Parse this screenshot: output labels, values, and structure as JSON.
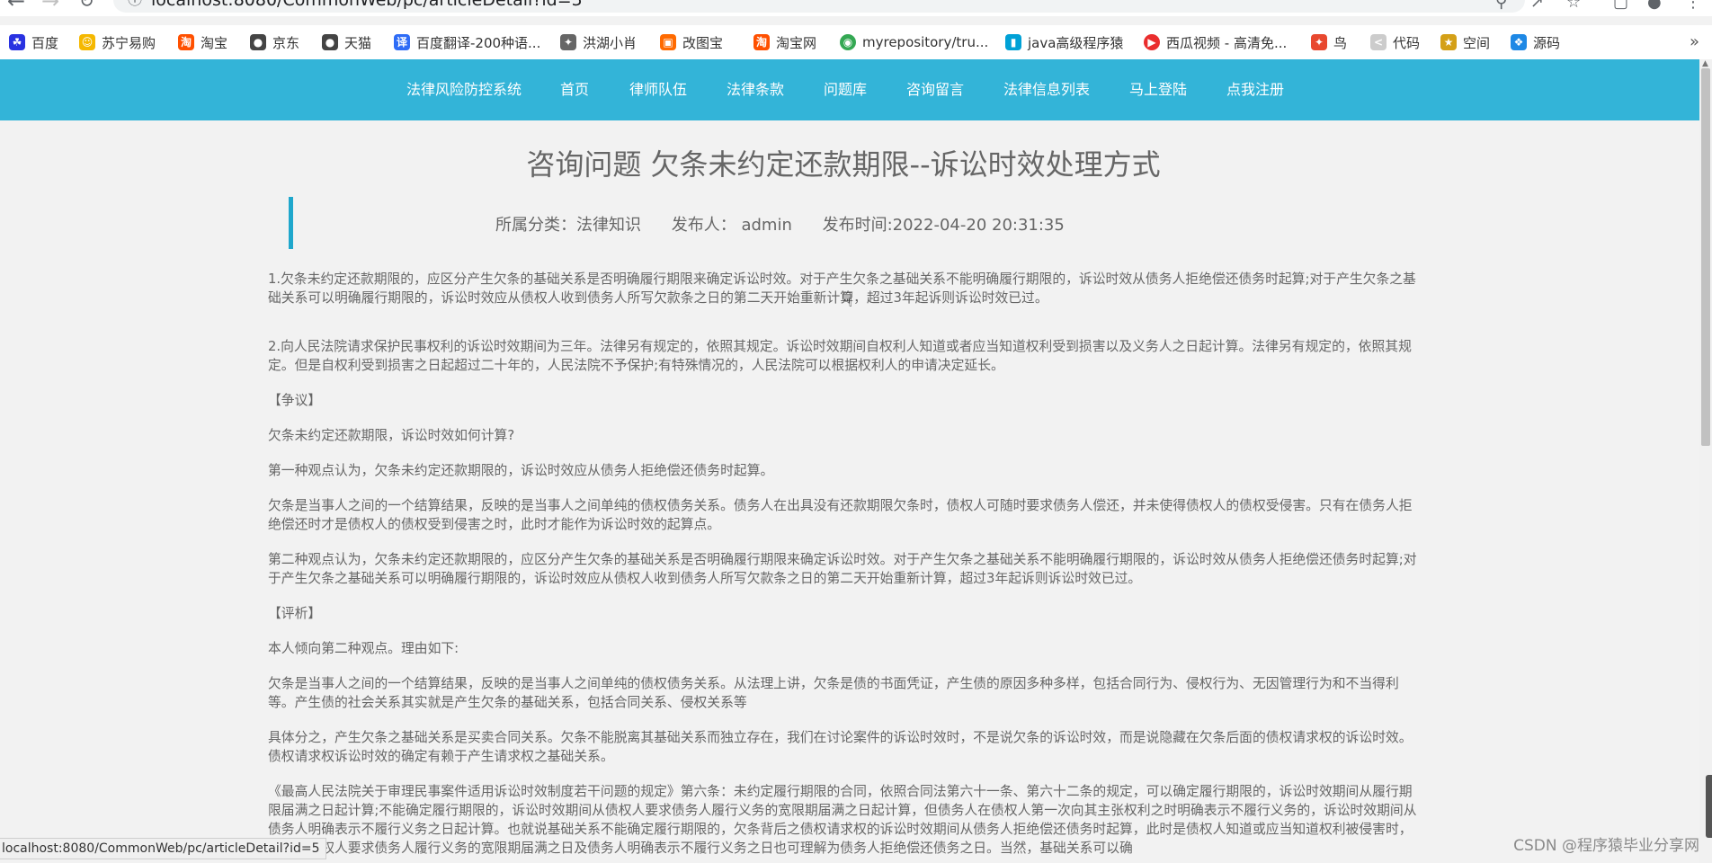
{
  "browser": {
    "url": "localhost:8080/CommonWeb/pc/articleDetail?id=5",
    "bookmarks": [
      {
        "label": "百度",
        "color": "#2932e1"
      },
      {
        "label": "苏宁易购",
        "color": "#f5b800"
      },
      {
        "label": "淘宝",
        "color": "#ff5000"
      },
      {
        "label": "京东",
        "color": "#444444"
      },
      {
        "label": "天猫",
        "color": "#444444"
      },
      {
        "label": "百度翻译-200种语...",
        "color": "#2e6cf6"
      },
      {
        "label": "洪湖小肖",
        "color": "#666666"
      },
      {
        "label": "改图宝",
        "color": "#ff6a00"
      },
      {
        "label": "淘宝网",
        "color": "#ff5000"
      },
      {
        "label": "myrepository/tru...",
        "color": "#34a853"
      },
      {
        "label": "java高级程序猿",
        "color": "#00a1d6"
      },
      {
        "label": "西瓜视频 - 高清免...",
        "color": "#ea2d2d"
      },
      {
        "label": "鸟",
        "color": "#e8482f"
      },
      {
        "label": "代码",
        "color": "#cccccc"
      },
      {
        "label": "空间",
        "color": "#d4a017"
      },
      {
        "label": "源码",
        "color": "#1e88e5"
      }
    ],
    "bookmarks_more": "»",
    "status_url": "localhost:8080/CommonWeb/pc/articleDetail?id=5"
  },
  "nav": {
    "items": [
      "法律风险防控系统",
      "首页",
      "律师队伍",
      "法律条款",
      "问题库",
      "咨询留言",
      "法律信息列表",
      "马上登陆",
      "点我注册"
    ],
    "bg_color": "#33b4d8"
  },
  "article": {
    "title": "咨询问题 欠条未约定还款期限--诉讼时效处理方式",
    "category": "所属分类：法律知识",
    "publisher": "发布人： admin",
    "publish_time": "发布时间:2022-04-20 20:31:35",
    "paragraphs": [
      "1.欠条未约定还款期限的，应区分产生欠条的基础关系是否明确履行期限来确定诉讼时效。对于产生欠条之基础关系不能明确履行期限的，诉讼时效从债务人拒绝偿还债务时起算;对于产生欠条之基础关系可以明确履行期限的，诉讼时效应从债权人收到债务人所写欠款条之日的第二天开始重新计算，超过3年起诉则诉讼时效已过。",
      "2.向人民法院请求保护民事权利的诉讼时效期间为三年。法律另有规定的，依照其规定。诉讼时效期间自权利人知道或者应当知道权利受到损害以及义务人之日起计算。法律另有规定的，依照其规定。但是自权利受到损害之日起超过二十年的，人民法院不予保护;有特殊情况的，人民法院可以根据权利人的申请决定延长。",
      "【争议】",
      "欠条未约定还款期限，诉讼时效如何计算?",
      "第一种观点认为，欠条未约定还款期限的，诉讼时效应从债务人拒绝偿还债务时起算。",
      "欠条是当事人之间的一个结算结果，反映的是当事人之间单纯的债权债务关系。债务人在出具没有还款期限欠条时，债权人可随时要求债务人偿还，并未使得债权人的债权受侵害。只有在债务人拒绝偿还时才是债权人的债权受到侵害之时，此时才能作为诉讼时效的起算点。",
      "第二种观点认为，欠条未约定还款期限的，应区分产生欠条的基础关系是否明确履行期限来确定诉讼时效。对于产生欠条之基础关系不能明确履行期限的，诉讼时效从债务人拒绝偿还债务时起算;对于产生欠条之基础关系可以明确履行期限的，诉讼时效应从债权人收到债务人所写欠款条之日的第二天开始重新计算，超过3年起诉则诉讼时效已过。",
      "【评析】",
      "本人倾向第二种观点。理由如下:",
      "欠条是当事人之间的一个结算结果，反映的是当事人之间单纯的债权债务关系。从法理上讲，欠条是债的书面凭证，产生债的原因多种多样，包括合同行为、侵权行为、无因管理行为和不当得利等。产生债的社会关系其实就是产生欠条的基础关系，包括合同关系、侵权关系等",
      "具体分之，产生欠条之基础关系是买卖合同关系。欠条不能脱离其基础关系而独立存在，我们在讨论案件的诉讼时效时，不是说欠条的诉讼时效，而是说隐藏在欠条后面的债权请求权的诉讼时效。债权请求权诉讼时效的确定有赖于产生请求权之基础关系。",
      "《最高人民法院关于审理民事案件适用诉讼时效制度若干问题的规定》第六条：未约定履行期限的合同，依照合同法第六十一条、第六十二条的规定，可以确定履行期限的，诉讼时效期间从履行期限届满之日起计算;不能确定履行期限的，诉讼时效期间从债权人要求债务人履行义务的宽限期届满之日起计算，但债务人在债权人第一次向其主张权利之时明确表示不履行义务的，诉讼时效期间从债务人明确表示不履行义务之日起计算。也就说基础关系不能确定履行期限的，欠条背后之债权请求权的诉讼时效期间从债务人拒绝偿还债务时起算，此时是债权人知道或应当知道权利被侵害时，同时，债权人要求债务人履行义务的宽限期届满之日及债务人明确表示不履行义务之日也可理解为债务人拒绝偿还债务之日。当然，基础关系可以确"
    ]
  },
  "watermark": "CSDN @程序猿毕业分享网"
}
